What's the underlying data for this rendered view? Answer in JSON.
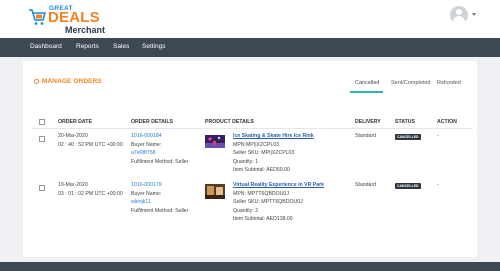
{
  "brand": {
    "line1": "GREAT",
    "line2": "DEALS",
    "line3": "Merchant"
  },
  "nav": {
    "items": [
      "Dashboard",
      "Reports",
      "Sales",
      "Settings"
    ]
  },
  "page": {
    "title": "MANAGE ORDERS",
    "tabs": [
      "Cancelled",
      "Sent/Completed",
      "Refunded"
    ],
    "active_tab": "Cancelled"
  },
  "table": {
    "headers": [
      "ORDER DATE",
      "ORDER DETAILS",
      "PRODUCT DETAILS",
      "DELIVERY",
      "STATUS",
      "ACTION"
    ],
    "rows": [
      {
        "date": "20-Mar-2020",
        "time": "02 : 40 : 52 PM UTC +00:00",
        "order_id": "1016-000184",
        "buyer_label": "Buyer Name:",
        "buyer_name": "a7e08f758",
        "fulfilment": "Fulfilment Method: Seller",
        "product_name": "Ice Skating & Skate Hire Ice Rink",
        "mpn": "MPN:MPI|XZCPL03",
        "seller_sku": "Seller SKU: MPI|XZCPL03",
        "quantity": "Quantity: 1",
        "subtotal": "Item Subtotal: AED50.00",
        "delivery": "Standard",
        "status": "CANCELLED",
        "action": "-"
      },
      {
        "date": "19-Mar-2020",
        "time": "03 : 01 : 02 PM UTC +00:00",
        "order_id": "1016-000179",
        "buyer_label": "Buyer Name:",
        "buyer_name": "wlenjk11",
        "fulfilment": "Fulfilment Method: Seller",
        "product_name": "Virtual Reality Experience in VR Park",
        "mpn": "MPN: MPTT6QBDOU0J",
        "seller_sku": "Seller SKU: MPTT6QBDOU0J",
        "quantity": "Quantity: 2",
        "subtotal": "Item Subtotal: AED138.00",
        "delivery": "Standard",
        "status": "CANCELLED",
        "action": "-"
      }
    ]
  },
  "icons": [
    "cart-icon",
    "avatar-icon",
    "chevron-down-icon",
    "orders-icon"
  ],
  "colors": {
    "accent": "#f0831f",
    "nav": "#3d4853",
    "tab_active": "#2bb3b1",
    "link": "#2b7bd6",
    "badge": "#2f3740"
  }
}
